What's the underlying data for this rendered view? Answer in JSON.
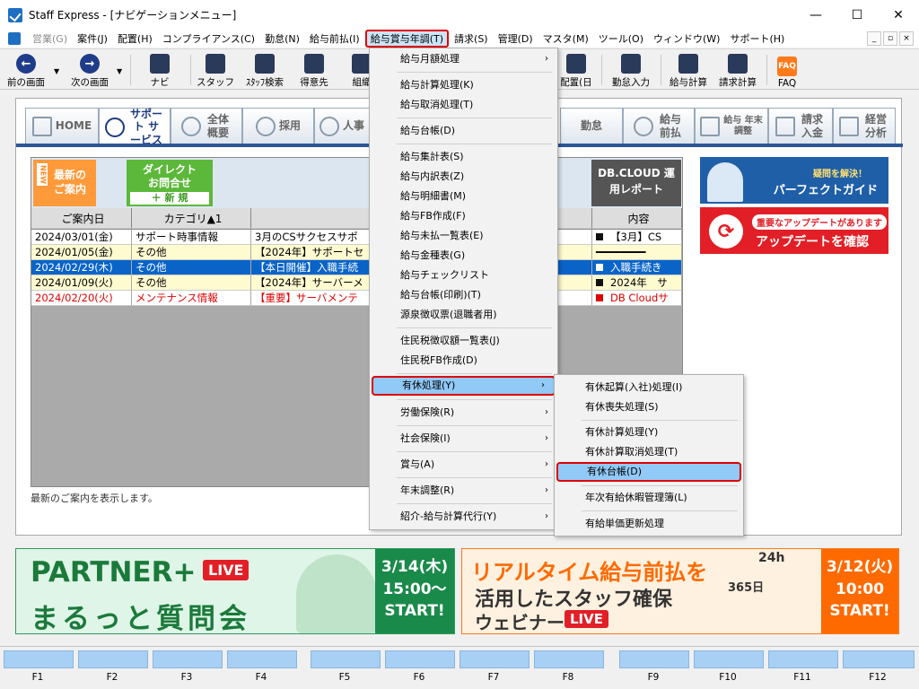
{
  "window": {
    "title": "Staff Express - [ナビゲーションメニュー]",
    "minimize": "—",
    "maximize": "☐",
    "close": "✕"
  },
  "menubar": {
    "items": [
      "営業(G)",
      "案件(J)",
      "配置(H)",
      "コンプライアンス(C)",
      "勤怠(N)",
      "給与前払(I)",
      "給与賞与年調(T)",
      "請求(S)",
      "管理(D)",
      "マスタ(M)",
      "ツール(O)",
      "ウィンドウ(W)",
      "サポート(H)"
    ],
    "mdi": [
      "_",
      "▫",
      "×"
    ]
  },
  "toolbar": {
    "back": "前の画面",
    "forward": "次の画面",
    "navi": "ナビ",
    "staff": "スタッフ",
    "staff_search": "ｽﾀｯﾌ検索",
    "client": "得意先",
    "org": "組織",
    "haichi": "配置(日",
    "kintai_input": "勤怠入力",
    "payroll_calc": "給与計算",
    "invoice_calc": "請求計算",
    "faq": "FAQ",
    "faq_icon": "FAQ"
  },
  "tabs": {
    "home": "HOME",
    "support": "サポート サービス",
    "overview": "全体 概要",
    "hiring": "採用",
    "hr": "人事",
    "kintai": "勤怠",
    "prepay": "給与 前払",
    "nenmatsu": "給与 年末調整",
    "invoice": "請求 入金",
    "analysis": "経営 分析"
  },
  "news": {
    "newest_tag": "NEW",
    "newest_btn": "最新の ご案内",
    "direct_btn": "ダイレクト お問合せ",
    "direct_sub": "＋ 新 規",
    "dbcloud_btn": "DB.CLOUD 運用レポート",
    "columns": [
      "ご案内日",
      "カテゴリ▲1",
      "",
      "内容"
    ],
    "rows": [
      {
        "date": "2024/03/01(金)",
        "cat": "サポート時事情報",
        "title": "3月のCSサクセスサポ",
        "content": "【3月】CS"
      },
      {
        "date": "2024/01/05(金)",
        "cat": "その他",
        "title": "【2024年】サポートセ",
        "content": "━━━━━━━━"
      },
      {
        "date": "2024/02/29(木)",
        "cat": "その他",
        "title": "【本日開催】入職手続",
        "content": "入職手続き"
      },
      {
        "date": "2024/01/09(火)",
        "cat": "その他",
        "title": "【2024年】サーバーメ",
        "content": "2024年　サ"
      },
      {
        "date": "2024/02/20(火)",
        "cat": "メンテナンス情報",
        "title": "【重要】サーバメンテ",
        "content": "DB Cloudサ"
      }
    ],
    "status": "最新のご案内を表示します。"
  },
  "side": {
    "guide_small": "疑問を解決！",
    "guide_big": "パーフェクトガイド",
    "update_small": "重要なアップデートがあります",
    "update_big": "アップデートを確認"
  },
  "banners": {
    "b1_line1": "PARTNER+",
    "b1_live": "LIVE",
    "b1_line2": "まるっと質問会",
    "b1_date": "3/14(木)",
    "b1_time": "15:00～",
    "b1_start": "START!",
    "b2_line1": "リアルタイム給与前払を",
    "b2_line2": "活用したスタッフ確保",
    "b2_line3": "ウェビナー",
    "b2_live": "LIVE",
    "b2_24h": "24h",
    "b2_365": "365日",
    "b2_date": "3/12(火)",
    "b2_time": "10:00",
    "b2_start": "START!"
  },
  "fkeys": [
    "F1",
    "F2",
    "F3",
    "F4",
    "F5",
    "F6",
    "F7",
    "F8",
    "F9",
    "F10",
    "F11",
    "F12"
  ],
  "menu_payroll": [
    {
      "label": "給与月額処理",
      "sub": true
    },
    {
      "label": "給与計算処理(K)"
    },
    {
      "label": "給与取消処理(T)"
    },
    {
      "label": "給与台帳(D)"
    },
    {
      "label": "給与集計表(S)"
    },
    {
      "label": "給与内訳表(Z)"
    },
    {
      "label": "給与明細書(M)"
    },
    {
      "label": "給与FB作成(F)"
    },
    {
      "label": "給与未払一覧表(E)"
    },
    {
      "label": "給与金種表(G)"
    },
    {
      "label": "給与チェックリスト"
    },
    {
      "label": "給与台帳(印刷)(T)"
    },
    {
      "label": "源泉徴収票(退職者用)"
    },
    {
      "label": "住民税徴収額一覧表(J)"
    },
    {
      "label": "住民税FB作成(D)"
    },
    {
      "label": "有休処理(Y)",
      "sub": true
    },
    {
      "label": "労働保険(R)",
      "sub": true
    },
    {
      "label": "社会保険(I)",
      "sub": true
    },
    {
      "label": "賞与(A)",
      "sub": true
    },
    {
      "label": "年末調整(R)",
      "sub": true
    },
    {
      "label": "紹介-給与計算代行(Y)",
      "sub": true
    }
  ],
  "menu_paid_leave": [
    {
      "label": "有休起算(入社)処理(I)"
    },
    {
      "label": "有休喪失処理(S)"
    },
    {
      "label": "有休計算処理(Y)"
    },
    {
      "label": "有休計算取消処理(T)"
    },
    {
      "label": "有休台帳(D)"
    },
    {
      "label": "年次有給休暇管理簿(L)"
    },
    {
      "label": "有給単価更新処理"
    }
  ],
  "colors": {
    "accent": "#1b3a80",
    "highlight_border": "#e00000",
    "menu_highlight": "#91c9f7",
    "selected_row": "#0a64c8"
  }
}
